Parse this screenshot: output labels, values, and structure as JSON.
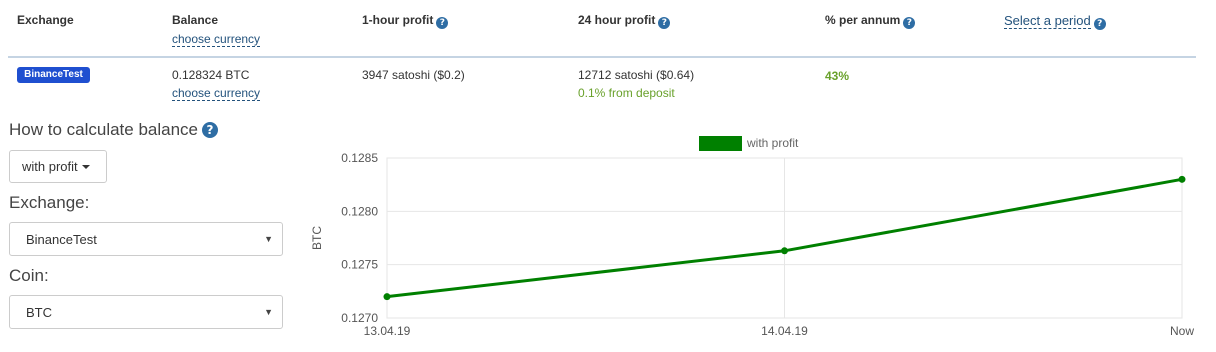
{
  "table": {
    "headers": {
      "exchange": "Exchange",
      "balance": "Balance",
      "balance_link": "choose currency",
      "hour_profit": "1-hour profit",
      "day_profit": "24 hour profit",
      "per_annum": "% per annum",
      "period_link": "Select a period"
    },
    "row": {
      "exchange_badge": "BinanceTest",
      "balance": "0.128324 BTC",
      "balance_link": "choose currency",
      "hour_profit": "3947 satoshi ($0.2)",
      "day_profit": "12712 satoshi ($0.64)",
      "day_profit_note": "0.1% from deposit",
      "per_annum": "43%"
    },
    "help_icon": "?"
  },
  "controls": {
    "balance_title": "How to calculate balance",
    "balance_mode": "with profit",
    "exchange_label": "Exchange:",
    "exchange_value": "BinanceTest",
    "coin_label": "Coin:",
    "coin_value": "BTC",
    "select_arrow": "▼"
  },
  "colors": {
    "line": "#008000",
    "badge": "#1f4fd0",
    "link": "#23527c",
    "positive": "#69a12b"
  },
  "chart_data": {
    "type": "line",
    "x": [
      "13.04.19",
      "14.04.19",
      "Now"
    ],
    "series": [
      {
        "name": "with profit",
        "values": [
          0.1272,
          0.12763,
          0.1283
        ]
      }
    ],
    "xlabel": "",
    "ylabel": "BTC",
    "ylim": [
      0.127,
      0.1285
    ],
    "yticks": [
      "0.1285",
      "0.1280",
      "0.1275",
      "0.1270"
    ],
    "grid": true,
    "legend_position": "top"
  }
}
